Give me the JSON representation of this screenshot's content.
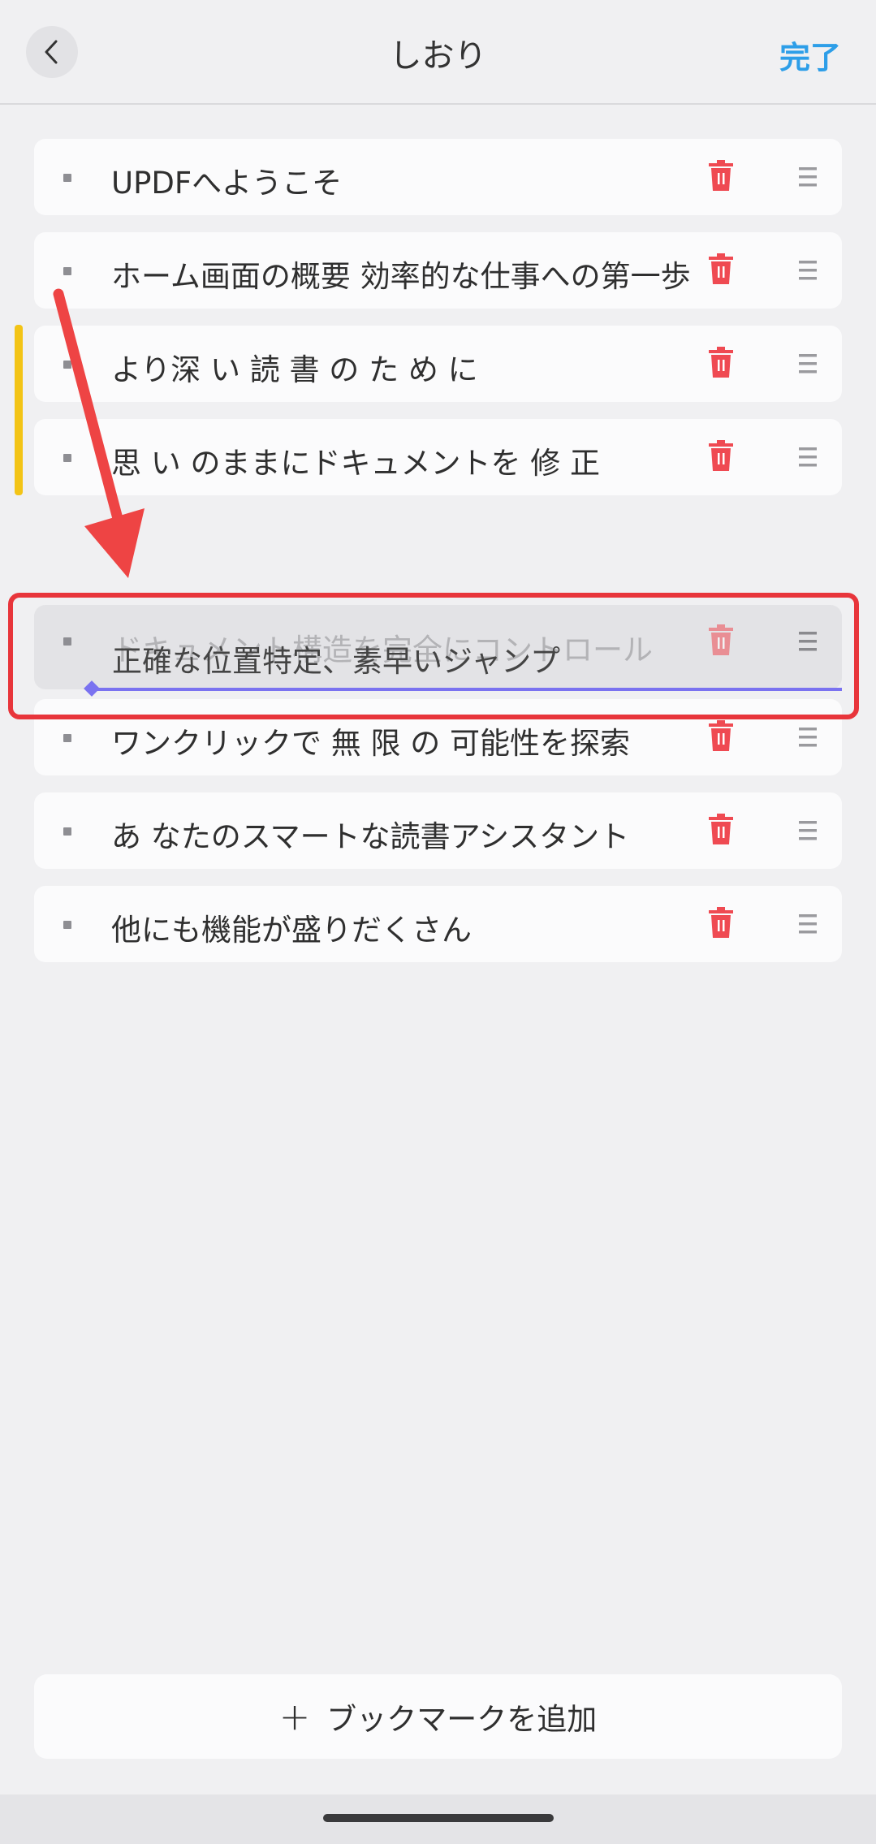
{
  "header": {
    "title": "しおり",
    "done_label": "完了"
  },
  "bookmarks": [
    {
      "label": "UPDFへようこそ"
    },
    {
      "label": "ホーム画面の概要 効率的な仕事への第一歩"
    },
    {
      "label": "より深 い 読 書 の た め に"
    },
    {
      "label": "思 い のままにドキュメントを 修 正"
    },
    {
      "label": "ワンクリックで 無 限 の 可能性を探索"
    },
    {
      "label": "あ なたのスマートな読書アシスタント"
    },
    {
      "label": "他にも機能が盛りだくさん"
    }
  ],
  "drag": {
    "ghost_label": "ドキュメント構造を完全にコントロール",
    "dragged_label": "正確な位置特定、素早いジャンプ"
  },
  "footer": {
    "add_label": "ブックマークを追加"
  },
  "colors": {
    "accent": "#2d9ee8",
    "delete": "#ef4a52",
    "drop_indicator": "#7a72f0",
    "annotation_red": "#e8353b",
    "moved_marker": "#f3c416"
  }
}
